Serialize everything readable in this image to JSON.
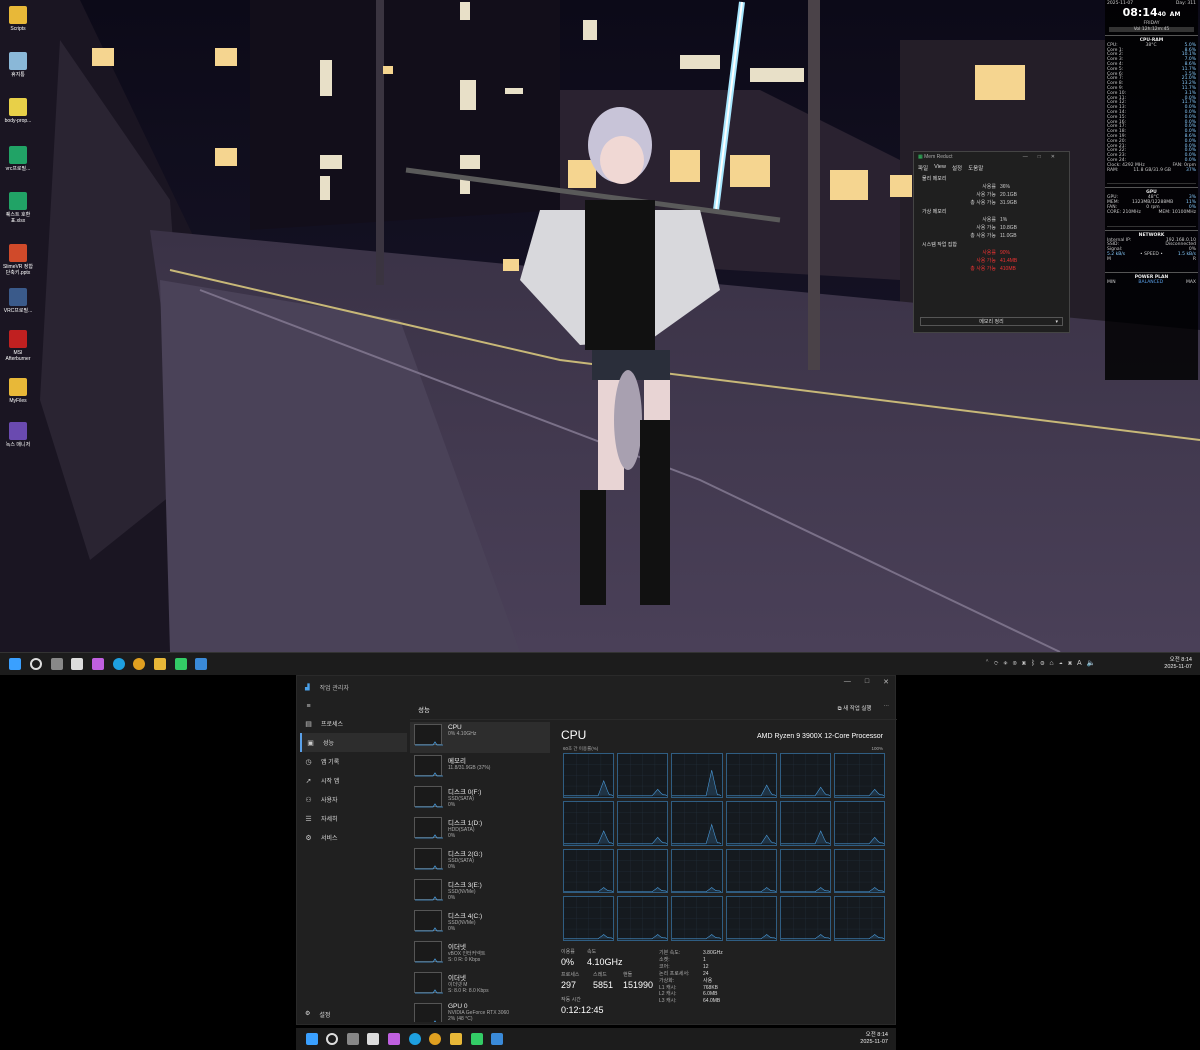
{
  "desktop": {
    "icons": [
      {
        "label": "Scripts",
        "icon": "folder-icon",
        "color": "#e8b838"
      },
      {
        "label": "휴지통",
        "icon": "recycle-bin-icon",
        "color": "#8ab8d8"
      },
      {
        "label": "body-prop...",
        "icon": "text-file-icon",
        "color": "#e8d048"
      },
      {
        "label": "vrc프로필...",
        "icon": "excel-icon",
        "color": "#21a366"
      },
      {
        "label": "퀘스트 호환표.xlsx",
        "icon": "excel-icon",
        "color": "#21a366"
      },
      {
        "label": "SlimeVR 정합 단축키.pptx",
        "icon": "powerpoint-icon",
        "color": "#d04a2a"
      },
      {
        "label": "VRC프로필...",
        "icon": "image-file-icon",
        "color": "#3a5a8a"
      },
      {
        "label": "MSI Afterburner",
        "icon": "afterburner-icon",
        "color": "#c02020"
      },
      {
        "label": "MyFiles",
        "icon": "folder-icon",
        "color": "#e8b838"
      },
      {
        "label": "녹스 매니저",
        "icon": "resonite-icon",
        "color": "#6a4ab0"
      }
    ]
  },
  "gadget": {
    "date": "2025-11-07",
    "day": "Day: 311",
    "time": "08:14",
    "seconds": "40",
    "ampm": "AM",
    "weekday": "FRIDAY",
    "uptime": "Vol 12h:12m:45",
    "cpu_title": "CPU-RAM",
    "cpu_label": "CPU:",
    "cpu_temp": "38°C",
    "cpu_pct": "5.0%",
    "cores": [
      {
        "name": "Core 1:",
        "val": "8.6%"
      },
      {
        "name": "Core 2:",
        "val": "10.1%"
      },
      {
        "name": "Core 3:",
        "val": "7.0%"
      },
      {
        "name": "Core 4:",
        "val": "8.6%"
      },
      {
        "name": "Core 5:",
        "val": "11.7%"
      },
      {
        "name": "Core 6:",
        "val": "1.5%"
      },
      {
        "name": "Core 7:",
        "val": "21.0%"
      },
      {
        "name": "Core 8:",
        "val": "13.2%"
      },
      {
        "name": "Core 9:",
        "val": "11.7%"
      },
      {
        "name": "Core 10:",
        "val": "3.1%"
      },
      {
        "name": "Core 11:",
        "val": "0.0%"
      },
      {
        "name": "Core 12:",
        "val": "11.7%"
      },
      {
        "name": "Core 13:",
        "val": "0.0%"
      },
      {
        "name": "Core 14:",
        "val": "0.0%"
      },
      {
        "name": "Core 15:",
        "val": "0.0%"
      },
      {
        "name": "Core 16:",
        "val": "0.0%"
      },
      {
        "name": "Core 17:",
        "val": "0.0%"
      },
      {
        "name": "Core 18:",
        "val": "0.0%"
      },
      {
        "name": "Core 19:",
        "val": "8.6%"
      },
      {
        "name": "Core 20:",
        "val": "0.0%"
      },
      {
        "name": "Core 21:",
        "val": "0.0%"
      },
      {
        "name": "Core 22:",
        "val": "0.0%"
      },
      {
        "name": "Core 23:",
        "val": "0.0%"
      },
      {
        "name": "Core 24:",
        "val": "0.0%"
      }
    ],
    "clock": "Clock: 4292 MHz",
    "fan": "FAN: 0rpm",
    "ram_label": "RAM:",
    "ram": "11.8 GB/31.9 GB",
    "ram_pct": "37%",
    "gpu_title": "GPU",
    "gpu_label": "GPU:",
    "gpu_temp": "48°C",
    "gpu_pct": "3%",
    "gmem_label": "MEM:",
    "gmem": "1323MB/12288MB",
    "gmem_pct": "11%",
    "gfan_label": "FAN:",
    "gfan": "0 rpm",
    "gfan_pct": "0%",
    "gcore": "CORE: 210MHz",
    "gmemclk": "MEM: 10100MHz",
    "net_title": "NETWORK",
    "ip_label": "Internal IP:",
    "ip": "192.168.0.10",
    "ssid_label": "SSID:",
    "ssid": "Disconnected",
    "signal_label": "Signal:",
    "signal": "0%",
    "down": "5.2 kB/s",
    "speed": "• SPEED •",
    "up": "1.5 kB/s",
    "m": "M",
    "r": "R",
    "power_title": "POWER PLAN",
    "power_min": "MIN",
    "power_mode": "BALANCED",
    "power_max": "MAX"
  },
  "memreduct": {
    "title": "Mem Reduct",
    "menu": [
      "파일",
      "View",
      "설정",
      "도움말"
    ],
    "physical": "물리 메모리",
    "p_rows": [
      {
        "k": "사용률",
        "v": "36%"
      },
      {
        "k": "사용 가능",
        "v": "20.1GB"
      },
      {
        "k": "총 사용 가능",
        "v": "31.9GB"
      }
    ],
    "virtual": "가상 메모리",
    "v_rows": [
      {
        "k": "사용률",
        "v": "1%"
      },
      {
        "k": "사용 가능",
        "v": "10.8GB"
      },
      {
        "k": "총 사용 가능",
        "v": "11.0GB"
      }
    ],
    "system": "시스템 작업 집합",
    "s_rows": [
      {
        "k": "사용률",
        "v": "90%"
      },
      {
        "k": "사용 가능",
        "v": "41.4MB"
      },
      {
        "k": "총 사용 가능",
        "v": "410MB"
      }
    ],
    "clean_button": "메모리 정리"
  },
  "taskbar1": {
    "time": "오전 8:14",
    "date": "2025-11-07"
  },
  "taskmgr": {
    "title": "작업 관리자",
    "nav": [
      {
        "label": "프로세스",
        "icon": "processes-icon",
        "glyph": "▤"
      },
      {
        "label": "성능",
        "icon": "performance-icon",
        "glyph": "▣"
      },
      {
        "label": "앱 기록",
        "icon": "history-icon",
        "glyph": "◷"
      },
      {
        "label": "시작 앱",
        "icon": "startup-icon",
        "glyph": "➚"
      },
      {
        "label": "사용자",
        "icon": "users-icon",
        "glyph": "⚇"
      },
      {
        "label": "자세히",
        "icon": "details-icon",
        "glyph": "☰"
      },
      {
        "label": "서비스",
        "icon": "services-icon",
        "glyph": "⚙"
      }
    ],
    "settings": "설정",
    "section": "성능",
    "new_task": "새 작업 실행",
    "devices": [
      {
        "name": "CPU",
        "sub1": "0% 4.10GHz",
        "sub2": ""
      },
      {
        "name": "메모리",
        "sub1": "11.8/31.9GB (37%)",
        "sub2": ""
      },
      {
        "name": "디스크 0(F:)",
        "sub1": "SSD(SATA)",
        "sub2": "0%"
      },
      {
        "name": "디스크 1(D:)",
        "sub1": "HDD(SATA)",
        "sub2": "0%"
      },
      {
        "name": "디스크 2(G:)",
        "sub1": "SSD(SATA)",
        "sub2": "0%"
      },
      {
        "name": "디스크 3(E:)",
        "sub1": "SSD(NVMe)",
        "sub2": "0%"
      },
      {
        "name": "디스크 4(C:)",
        "sub1": "SSD(NVMe)",
        "sub2": "0%"
      },
      {
        "name": "이더넷",
        "sub1": "vBOX 인터커넥트",
        "sub2": "S: 0 R: 0 Kbps"
      },
      {
        "name": "이더넷",
        "sub1": "이더넷 M",
        "sub2": "S: 8.0 R: 8.0 Kbps"
      },
      {
        "name": "GPU 0",
        "sub1": "NVIDIA GeForce RTX 3060",
        "sub2": "2% (48 °C)"
      }
    ],
    "cpu_title": "CPU",
    "cpu_model": "AMD Ryzen 9 3900X 12-Core Processor",
    "util_label": "60초 간 이용률(%)",
    "util_max": "100%",
    "usage_label": "이용률",
    "usage": "0%",
    "speed_label": "속도",
    "speed": "4.10GHz",
    "proc_label": "프로세스",
    "proc": "297",
    "thread_label": "스레드",
    "thread": "5851",
    "handle_label": "핸들",
    "handle": "151990",
    "uptime_label": "작동 시간",
    "uptime": "0:12:12:45",
    "spec": [
      {
        "k": "기본 속도:",
        "v": "3.80GHz"
      },
      {
        "k": "소켓:",
        "v": "1"
      },
      {
        "k": "코어:",
        "v": "12"
      },
      {
        "k": "논리 프로세서:",
        "v": "24"
      },
      {
        "k": "가상화:",
        "v": "사용"
      },
      {
        "k": "L1 캐시:",
        "v": "768KB"
      },
      {
        "k": "L2 캐시:",
        "v": "6.0MB"
      },
      {
        "k": "L3 캐시:",
        "v": "64.0MB"
      }
    ]
  },
  "taskbar2": {
    "time": "오전 8:14",
    "date": "2025-11-07"
  },
  "colors": {
    "accent": "#5aa0e8",
    "graph_border": "#2f5d82",
    "graph_line": "#4a9cdc",
    "red": "#e33333"
  }
}
